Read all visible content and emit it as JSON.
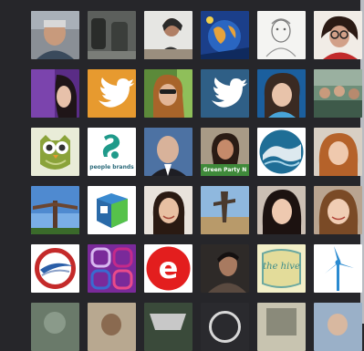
{
  "colors": {
    "background": "#26262a",
    "twitter_orange": "#e79a2f",
    "twitter_blue": "#2f5f86",
    "bird_white": "#ffffff"
  },
  "tiles": {
    "r1c1": {
      "icon": "avatar-man-smiling"
    },
    "r1c2": {
      "icon": "avatar-boots"
    },
    "r1c3": {
      "icon": "avatar-woman-at-desk"
    },
    "r1c4": {
      "icon": "avatar-globe-art"
    },
    "r1c5": {
      "icon": "avatar-sketch-portrait"
    },
    "r1c6": {
      "icon": "avatar-woman-glasses"
    },
    "r2c1": {
      "icon": "avatar-woman-purple"
    },
    "r2c2": {
      "icon": "twitter-bird-icon"
    },
    "r2c3": {
      "icon": "avatar-woman-sunglasses"
    },
    "r2c4": {
      "icon": "twitter-bird-icon"
    },
    "r2c5": {
      "icon": "avatar-woman-blue"
    },
    "r2c6": {
      "icon": "avatar-group-photo"
    },
    "r3c1": {
      "icon": "owl-logo"
    },
    "r3c2": {
      "icon": "people-brand-logo",
      "caption": "people brands"
    },
    "r3c3": {
      "icon": "avatar-bald-man"
    },
    "r3c4": {
      "icon": "avatar-woman-sign",
      "caption": "Green Party N"
    },
    "r3c5": {
      "icon": "wave-circle-logo"
    },
    "r3c6": {
      "icon": "avatar-woman-red-hair"
    },
    "r4c1": {
      "icon": "angel-of-north-photo"
    },
    "r4c2": {
      "icon": "product-box-logo"
    },
    "r4c3": {
      "icon": "avatar-woman-smiling"
    },
    "r4c4": {
      "icon": "sculpture-sky-photo"
    },
    "r4c5": {
      "icon": "avatar-woman-dark-hair"
    },
    "r4c6": {
      "icon": "avatar-woman-blonde"
    },
    "r5c1": {
      "icon": "compass-logo"
    },
    "r5c2": {
      "icon": "purple-squares-logo"
    },
    "r5c3": {
      "icon": "red-e-logo",
      "letter": "e"
    },
    "r5c4": {
      "icon": "avatar-man-dark"
    },
    "r5c5": {
      "icon": "the-hive-logo",
      "caption": "the hive"
    },
    "r5c6": {
      "icon": "wind-turbine-icon"
    },
    "r6c1": {
      "icon": "avatar-partial-1"
    },
    "r6c2": {
      "icon": "avatar-partial-2"
    },
    "r6c3": {
      "icon": "avatar-partial-3"
    },
    "r6c4": {
      "icon": "avatar-partial-4"
    },
    "r6c5": {
      "icon": "avatar-partial-5"
    },
    "r6c6": {
      "icon": "avatar-partial-6"
    }
  }
}
